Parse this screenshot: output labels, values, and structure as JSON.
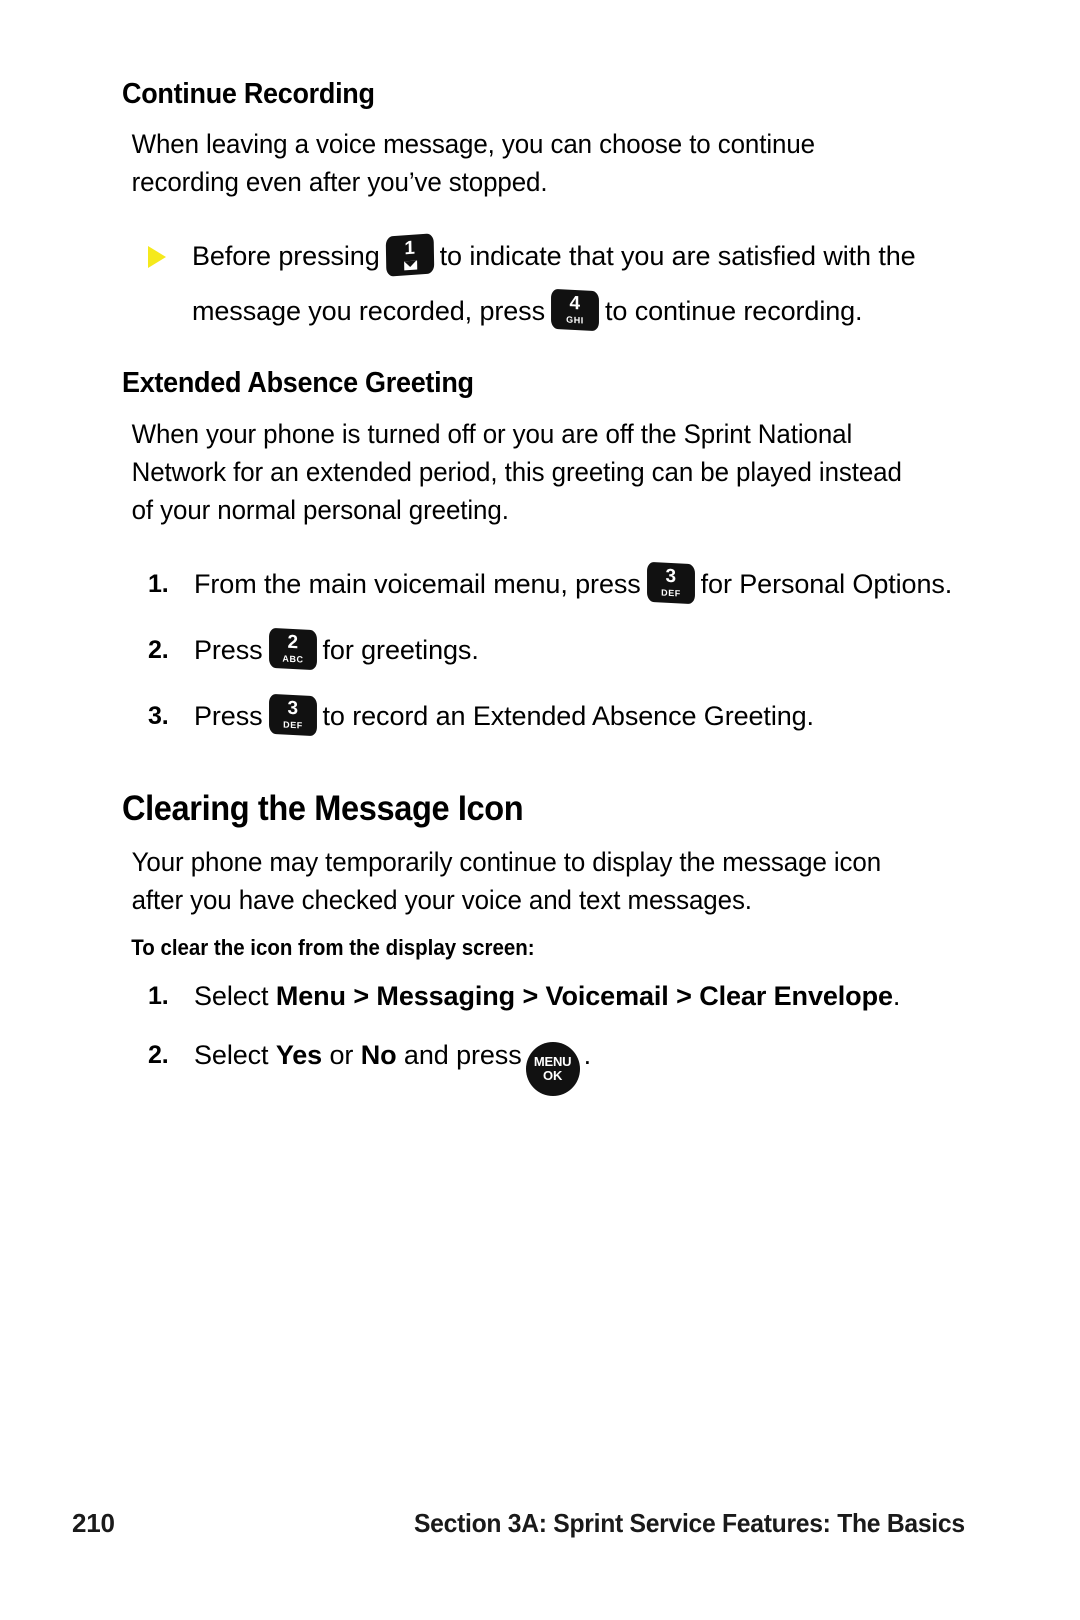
{
  "page": {
    "footer_page_number": "210",
    "footer_section": "Section 3A: Sprint Service Features: The Basics"
  },
  "sections": {
    "continue_recording": {
      "heading": "Continue Recording",
      "paragraph": "When leaving a voice message, you can choose to continue recording even after you’ve stopped.",
      "bullet": {
        "marker": "arrow-bullet",
        "text_part1": "Before pressing",
        "key1": {
          "number": "1",
          "sub": "envelope"
        },
        "text_part2": "to indicate that you are satisfied with the message you recorded, press",
        "key2": {
          "number": "4",
          "sub": "GHI"
        },
        "text_part3": "to continue recording."
      }
    },
    "extended_absence_greeting": {
      "heading": "Extended Absence Greeting",
      "paragraph": "When your phone is turned off or you are off the Sprint National Network for an extended period, this greeting can be played instead of your normal personal greeting.",
      "steps": [
        {
          "marker": "1.",
          "text_part1": "From the main voicemail menu, press",
          "key": {
            "number": "3",
            "sub": "DEF"
          },
          "text_part2": "for Personal Options."
        },
        {
          "marker": "2.",
          "text_part1": "Press",
          "key": {
            "number": "2",
            "sub": "ABC"
          },
          "text_part2": "for greetings."
        },
        {
          "marker": "3.",
          "text_part1": "Press",
          "key": {
            "number": "3",
            "sub": "DEF"
          },
          "text_part2": "to record an Extended Absence Greeting."
        }
      ]
    },
    "clearing_the_message_icon": {
      "heading": "Clearing the Message Icon",
      "paragraph": "Your phone may temporarily continue to display the message icon after you have checked your voice and text messages.",
      "subheading": "To clear the icon from the display screen:",
      "steps": [
        {
          "marker": "1.",
          "text_part1": "Select ",
          "bold1": "Menu",
          "sep1": " > ",
          "bold2": "Messaging",
          "sep2": " > ",
          "bold3": "Voicemail",
          "sep3": " > ",
          "bold4": "Clear Envelope",
          "text_part2": "."
        },
        {
          "marker": "2.",
          "text_part1": "Select ",
          "bold1": "Yes",
          "mid1": " or ",
          "bold2": "No",
          "text_part2": " and press",
          "key": {
            "line1": "MENU",
            "line2": "OK"
          },
          "text_part3": "."
        }
      ]
    }
  },
  "colors": {
    "bullet_yellow": "#F5E91C",
    "key_black": "#111111",
    "text_black": "#000000"
  }
}
